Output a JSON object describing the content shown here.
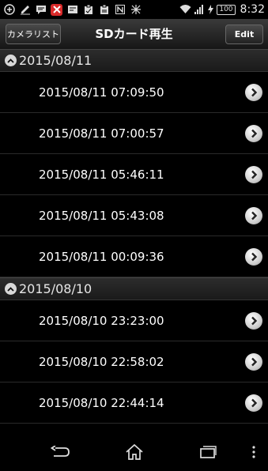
{
  "status_bar": {
    "time": "8:32",
    "battery": "100",
    "icons": [
      "usb-debug-icon",
      "pen-icon",
      "chat-icon",
      "missed-call-icon",
      "notification-icon",
      "clipboard-icon",
      "clipboard2-icon",
      "nfc-icon",
      "vibrate-off-icon",
      "wifi-icon",
      "signal-icon",
      "charging-icon"
    ]
  },
  "header": {
    "back_label": "カメラリスト",
    "title": "SDカード再生",
    "edit_label": "Edit"
  },
  "sections": [
    {
      "date": "2015/08/11",
      "items": [
        "2015/08/11 07:09:50",
        "2015/08/11 07:00:57",
        "2015/08/11 05:46:11",
        "2015/08/11 05:43:08",
        "2015/08/11 00:09:36"
      ]
    },
    {
      "date": "2015/08/10",
      "items": [
        "2015/08/10 23:23:00",
        "2015/08/10 22:58:02",
        "2015/08/10 22:44:14"
      ]
    }
  ],
  "nav_bar": {
    "buttons": [
      "back-icon",
      "home-icon",
      "recent-apps-icon",
      "menu-icon"
    ]
  }
}
